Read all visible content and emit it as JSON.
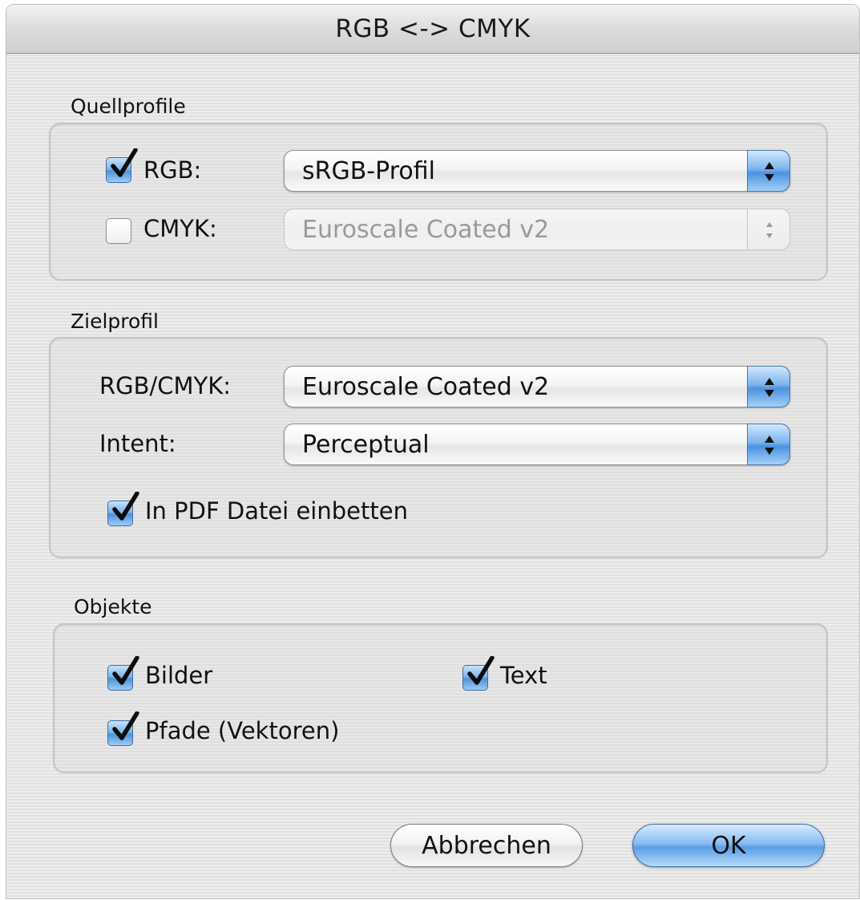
{
  "window": {
    "title": "RGB <-> CMYK"
  },
  "source_profiles": {
    "heading": "Quellprofile",
    "rgb": {
      "checked": true,
      "label": "RGB:",
      "profile": "sRGB-Profil",
      "enabled": true
    },
    "cmyk": {
      "checked": false,
      "label": "CMYK:",
      "profile": "Euroscale Coated v2",
      "enabled": false
    }
  },
  "target_profile": {
    "heading": "Zielprofil",
    "rgb_cmyk_label": "RGB/CMYK:",
    "rgb_cmyk_value": "Euroscale Coated v2",
    "intent_label": "Intent:",
    "intent_value": "Perceptual",
    "embed": {
      "checked": true,
      "label": "In PDF Datei einbetten"
    }
  },
  "objects": {
    "heading": "Objekte",
    "images": {
      "checked": true,
      "label": "Bilder"
    },
    "text": {
      "checked": true,
      "label": "Text"
    },
    "paths": {
      "checked": true,
      "label": "Pfade (Vektoren)"
    }
  },
  "buttons": {
    "cancel": "Abbrechen",
    "ok": "OK"
  },
  "colors": {
    "accent_blue": "#5a9de6",
    "disabled_text": "#9a9a9a"
  }
}
